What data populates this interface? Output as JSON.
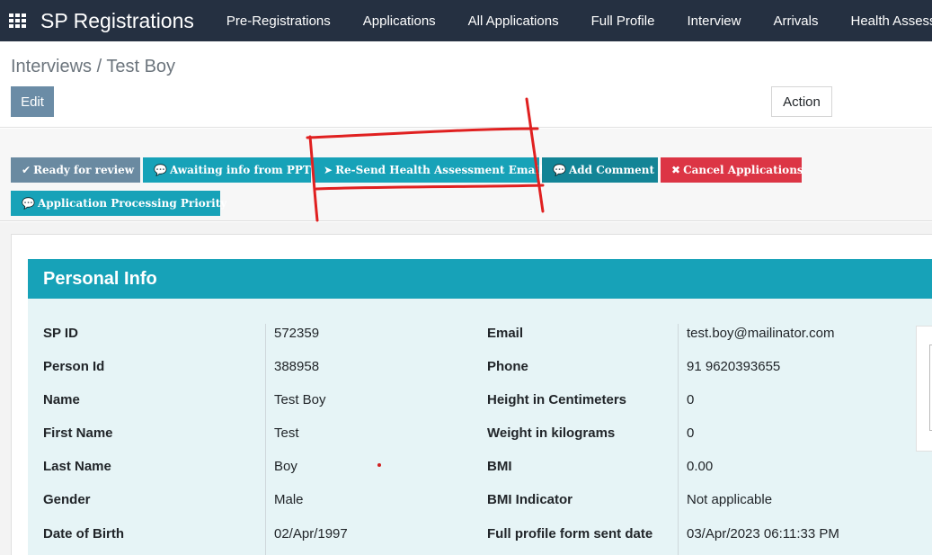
{
  "topbar": {
    "brand": "SP Registrations",
    "nav": [
      "Pre-Registrations",
      "Applications",
      "All Applications",
      "Full Profile",
      "Interview",
      "Arrivals",
      "Health Assessm"
    ]
  },
  "control_panel": {
    "breadcrumb": "Interviews / Test Boy",
    "edit_label": "Edit",
    "action_label": "Action"
  },
  "header_buttons": [
    {
      "label": "Ready for review",
      "icon": "check-icon"
    },
    {
      "label": "Awaiting info from PPT",
      "icon": "comment-icon"
    },
    {
      "label": "Re-Send Health Assessment Email",
      "icon": "paper-plane-icon"
    },
    {
      "label": "Add Comment",
      "icon": "comment-icon"
    },
    {
      "label": "Cancel Applications",
      "icon": "x-icon"
    },
    {
      "label": "Application Processing Priority",
      "icon": "comment-icon"
    }
  ],
  "section": {
    "title": "Personal Info"
  },
  "left_fields": [
    {
      "label": "SP ID",
      "value": "572359"
    },
    {
      "label": "Person Id",
      "value": "388958"
    },
    {
      "label": "Name",
      "value": "Test Boy"
    },
    {
      "label": "First Name",
      "value": "Test"
    },
    {
      "label": "Last Name",
      "value": "Boy"
    },
    {
      "label": "Gender",
      "value": "Male"
    },
    {
      "label": "Date of Birth",
      "value": "02/Apr/1997"
    }
  ],
  "right_fields": [
    {
      "label": "Email",
      "value": "test.boy@mailinator.com"
    },
    {
      "label": "Phone",
      "value": "91 9620393655"
    },
    {
      "label": "Height in Centimeters",
      "value": "0"
    },
    {
      "label": "Weight in kilograms",
      "value": "0"
    },
    {
      "label": "BMI",
      "value": "0.00"
    },
    {
      "label": "BMI Indicator",
      "value": "Not applicable"
    },
    {
      "label": "Full profile form sent date",
      "value": "03/Apr/2023 06:11:33 PM"
    }
  ],
  "colors": {
    "topbar": "#253041",
    "teal": "#17a2b8",
    "dark_teal": "#138496",
    "grey_blue": "#6a8aa1",
    "red": "#dc3545",
    "annotation": "#e02020"
  }
}
